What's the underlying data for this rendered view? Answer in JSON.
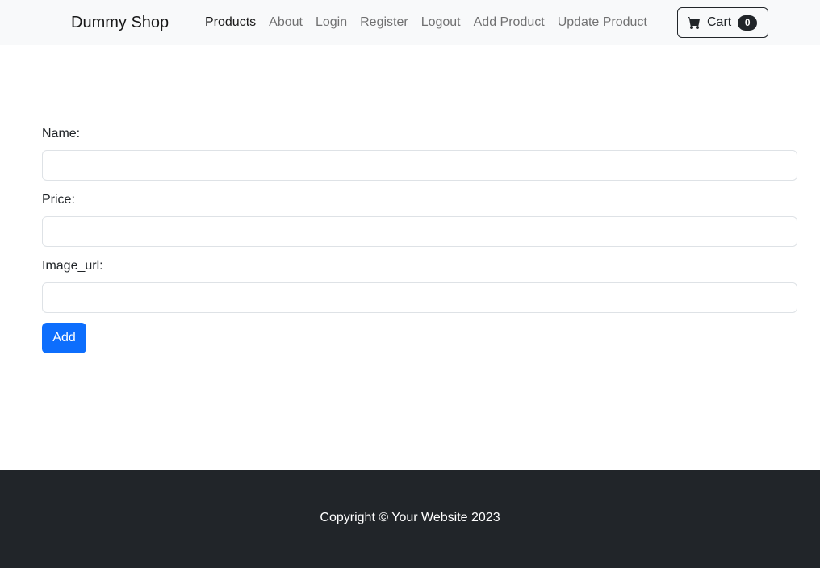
{
  "navbar": {
    "brand": "Dummy Shop",
    "links": [
      {
        "label": "Products",
        "active": true
      },
      {
        "label": "About"
      },
      {
        "label": "Login"
      },
      {
        "label": "Register"
      },
      {
        "label": "Logout"
      },
      {
        "label": "Add Product"
      },
      {
        "label": "Update Product"
      }
    ],
    "cart": {
      "label": "Cart",
      "count": "0",
      "icon": "cart-icon"
    }
  },
  "form": {
    "fields": [
      {
        "label": "Name:",
        "value": "",
        "placeholder": ""
      },
      {
        "label": "Price:",
        "value": "",
        "placeholder": ""
      },
      {
        "label": "Image_url:",
        "value": "",
        "placeholder": ""
      }
    ],
    "submit_label": "Add"
  },
  "footer": {
    "text": "Copyright © Your Website 2023"
  },
  "colors": {
    "primary": "#0d6efd",
    "dark": "#212529",
    "navbar_bg": "#f8f9fa"
  }
}
